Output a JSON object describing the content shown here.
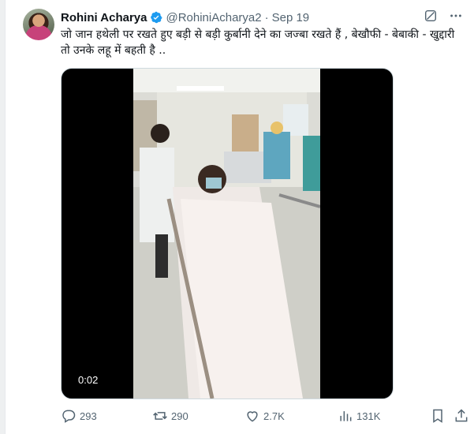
{
  "user": {
    "name": "Rohini Acharya",
    "handle": "@RohiniAcharya2",
    "separator": "·",
    "date": "Sep 19",
    "verified_color": "#1d9bf0"
  },
  "tweet": {
    "text": "जो जान हथेली पर रखते हुए बड़ी से बड़ी कुर्बानी देने का जज्बा रखते हैं , बेखौफी - बेबाकी - खुद्दारी तो उनके लहू में बहती है .."
  },
  "media": {
    "duration": "0:02"
  },
  "actions": {
    "replies": "293",
    "reposts": "290",
    "likes": "2.7K",
    "views": "131K"
  },
  "icons": [
    "verified-badge-icon",
    "grok-icon",
    "more-icon",
    "reply-icon",
    "repost-icon",
    "like-icon",
    "views-icon",
    "bookmark-icon",
    "share-icon"
  ],
  "colors": {
    "text": "#0f1419",
    "muted": "#536471",
    "accent": "#1d9bf0"
  }
}
